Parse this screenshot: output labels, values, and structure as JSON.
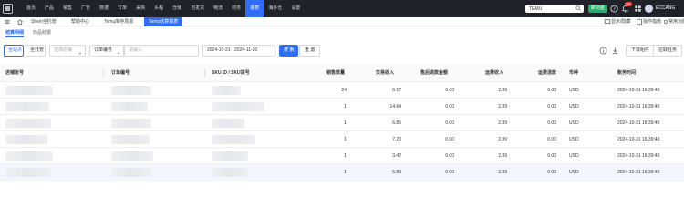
{
  "topnav": {
    "items": [
      "首页",
      "产品",
      "销售",
      "广告",
      "数据",
      "订单",
      "采购",
      "头程",
      "仓储",
      "自发货",
      "物流",
      "财务",
      "报表",
      "海外仓",
      "设置"
    ],
    "active_index": 12,
    "search_value": "TEMU",
    "new_button": "新功能",
    "notification_count": "20",
    "user": "ECCANG"
  },
  "tabbar": {
    "tabs": [
      "Shein全托管",
      "帮助中心",
      "Temu库存周报",
      "Temu结算报表"
    ],
    "active_index": 3,
    "right_items": [
      "显示/隐藏",
      "操作指南",
      "常用功能设置"
    ]
  },
  "subtabs": [
    "结算明细",
    "商品财报"
  ],
  "filters": {
    "site_select": "全站点",
    "site_text": "全托管",
    "store_placeholder": "选择店铺",
    "order_type": "订单编号",
    "order_placeholder": "请输入",
    "date_start": "2024-10-21",
    "date_sep": "-",
    "date_end": "2024-11-20",
    "search_button": "搜 索",
    "reset_button": "重 置",
    "download_center": "下载组件",
    "export_task": "拉取任务"
  },
  "table": {
    "columns": [
      "店铺账号",
      "订单编号",
      "SKU ID / SKU货号",
      "销售数量",
      "交易收入",
      "售后退款金额",
      "运费收入",
      "运费退款",
      "币种",
      "账务时间"
    ],
    "rows": [
      {
        "qty": "24",
        "income": "6.17",
        "refund": "0.00",
        "ship_income": "2.89",
        "ship_refund": "0.00",
        "currency": "USD",
        "time": "2024-10-31 16:39:40"
      },
      {
        "qty": "1",
        "income": "14.64",
        "refund": "0.00",
        "ship_income": "2.89",
        "ship_refund": "0.00",
        "currency": "USD",
        "time": "2024-10-31 16:39:40"
      },
      {
        "qty": "1",
        "income": "6.85",
        "refund": "0.00",
        "ship_income": "2.89",
        "ship_refund": "0.00",
        "currency": "USD",
        "time": "2024-10-31 16:39:40"
      },
      {
        "qty": "1",
        "income": "7.20",
        "refund": "0.00",
        "ship_income": "2.89",
        "ship_refund": "0.00",
        "currency": "USD",
        "time": "2024-10-31 16:39:40"
      },
      {
        "qty": "1",
        "income": "3.42",
        "refund": "0.00",
        "ship_income": "2.89",
        "ship_refund": "0.00",
        "currency": "USD",
        "time": "2024-10-31 16:39:40"
      },
      {
        "qty": "1",
        "income": "5.89",
        "refund": "0.00",
        "ship_income": "2.89",
        "ship_refund": "0.00",
        "currency": "USD",
        "time": "2024-10-31 16:39:40"
      }
    ]
  },
  "colors": {
    "nav_bg": "#1f2329",
    "accent": "#2f6df6",
    "new_button": "#20b26b",
    "badge": "#ef4444"
  },
  "icons": [
    "logo-icon",
    "search-icon",
    "help-icon",
    "bell-icon",
    "grid-icon",
    "home-icon",
    "settings-icon",
    "download-icon",
    "info-icon"
  ]
}
